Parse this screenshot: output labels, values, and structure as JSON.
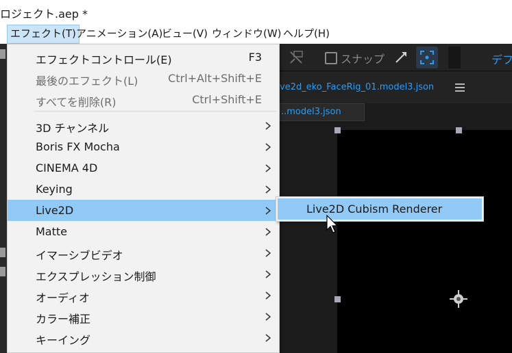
{
  "window": {
    "title": "ロジェクト.aep *"
  },
  "menubar": {
    "items": [
      {
        "label": "エフェクト(T)"
      },
      {
        "label": "アニメーション(A)"
      },
      {
        "label": "ビュー(V)"
      },
      {
        "label": "ウィンドウ(W)"
      },
      {
        "label": "ヘルプ(H)"
      }
    ]
  },
  "toolbar": {
    "snap_label": "スナップ",
    "workspace_label": "デフ"
  },
  "composition": {
    "tab_title": "ve2d_eko_FaceRig_01.model3.json",
    "sub_tab_label": "..model3.json"
  },
  "effect_menu": {
    "items": [
      {
        "label": "エフェクトコントロール(E)",
        "shortcut": "F3",
        "disabled": false
      },
      {
        "label": "最後のエフェクト(L)",
        "shortcut": "Ctrl+Alt+Shift+E",
        "disabled": true
      },
      {
        "label": "すべてを削除(R)",
        "shortcut": "Ctrl+Shift+E",
        "disabled": true
      },
      {
        "label": "3D チャンネル",
        "submenu": true
      },
      {
        "label": "Boris FX Mocha",
        "submenu": true
      },
      {
        "label": "CINEMA 4D",
        "submenu": true
      },
      {
        "label": "Keying",
        "submenu": true
      },
      {
        "label": "Live2D",
        "submenu": true,
        "highlighted": true
      },
      {
        "label": "Matte",
        "submenu": true
      },
      {
        "label": "イマーシブビデオ",
        "submenu": true
      },
      {
        "label": "エクスプレッション制御",
        "submenu": true
      },
      {
        "label": "オーディオ",
        "submenu": true
      },
      {
        "label": "カラー補正",
        "submenu": true
      },
      {
        "label": "キーイング",
        "submenu": true
      }
    ]
  },
  "live2d_submenu": {
    "items": [
      {
        "label": "Live2D Cubism Renderer",
        "highlighted": true
      }
    ]
  },
  "colors": {
    "menu_highlight": "#91c9f7",
    "menubar_active": "#cce4f7",
    "accent_blue": "#2e9bf0",
    "menu_bg": "#f2f2f2"
  },
  "icons": {
    "submenu_arrow": "chevron-right-icon",
    "hamburger": "hamburger-menu-icon",
    "anchor": "anchor-point-icon",
    "cursor": "mouse-pointer-icon"
  }
}
